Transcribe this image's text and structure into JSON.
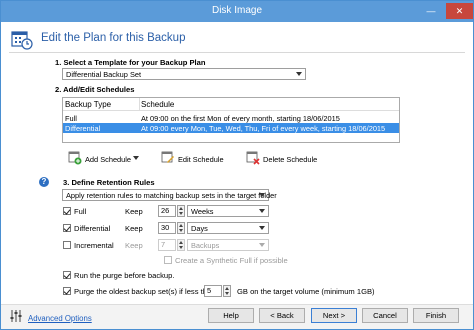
{
  "window": {
    "title": "Disk Image",
    "minimize_glyph": "—",
    "close_glyph": "✕"
  },
  "header": {
    "title": "Edit the Plan for this Backup",
    "icon": "calendar-icon"
  },
  "section1": {
    "label": "1. Select a Template for your Backup Plan",
    "selected": "Differential Backup Set"
  },
  "section2": {
    "label": "2. Add/Edit Schedules",
    "columns": [
      "Backup Type",
      "Schedule"
    ],
    "rows": [
      {
        "type": "Full",
        "schedule": "At 09:00 on the first Mon of every month, starting 18/06/2015",
        "selected": false
      },
      {
        "type": "Differential",
        "schedule": "At 09:00 every Mon, Tue, Wed, Thu, Fri of every week, starting 18/06/2015",
        "selected": true
      }
    ],
    "add_label": "Add Schedule",
    "edit_label": "Edit Schedule",
    "delete_label": "Delete Schedule"
  },
  "section3": {
    "label": "3. Define Retention Rules",
    "policy": "Apply retention rules to matching backup sets in the target folder",
    "keep_label": "Keep",
    "rules": [
      {
        "name": "Full",
        "checked": true,
        "enabled": true,
        "value": "26",
        "unit": "Weeks"
      },
      {
        "name": "Differential",
        "checked": true,
        "enabled": true,
        "value": "30",
        "unit": "Days"
      },
      {
        "name": "Incremental",
        "checked": false,
        "enabled": false,
        "value": "7",
        "unit": "Backups"
      }
    ],
    "synthetic_label": "Create a Synthetic Full if possible"
  },
  "purge": {
    "run_before_label": "Run the purge before backup.",
    "oldest_label": "Purge the oldest backup set(s) if less than",
    "oldest_value": "5",
    "oldest_suffix": "GB on the target volume (minimum 1GB)"
  },
  "footer": {
    "advanced": "Advanced Options",
    "help": "Help",
    "back": "< Back",
    "next": "Next >",
    "cancel": "Cancel",
    "finish": "Finish"
  },
  "colors": {
    "title_bar": "#5b9bd9",
    "accent": "#2b5fa8",
    "selection": "#3a8ee6",
    "close": "#c7473d"
  }
}
